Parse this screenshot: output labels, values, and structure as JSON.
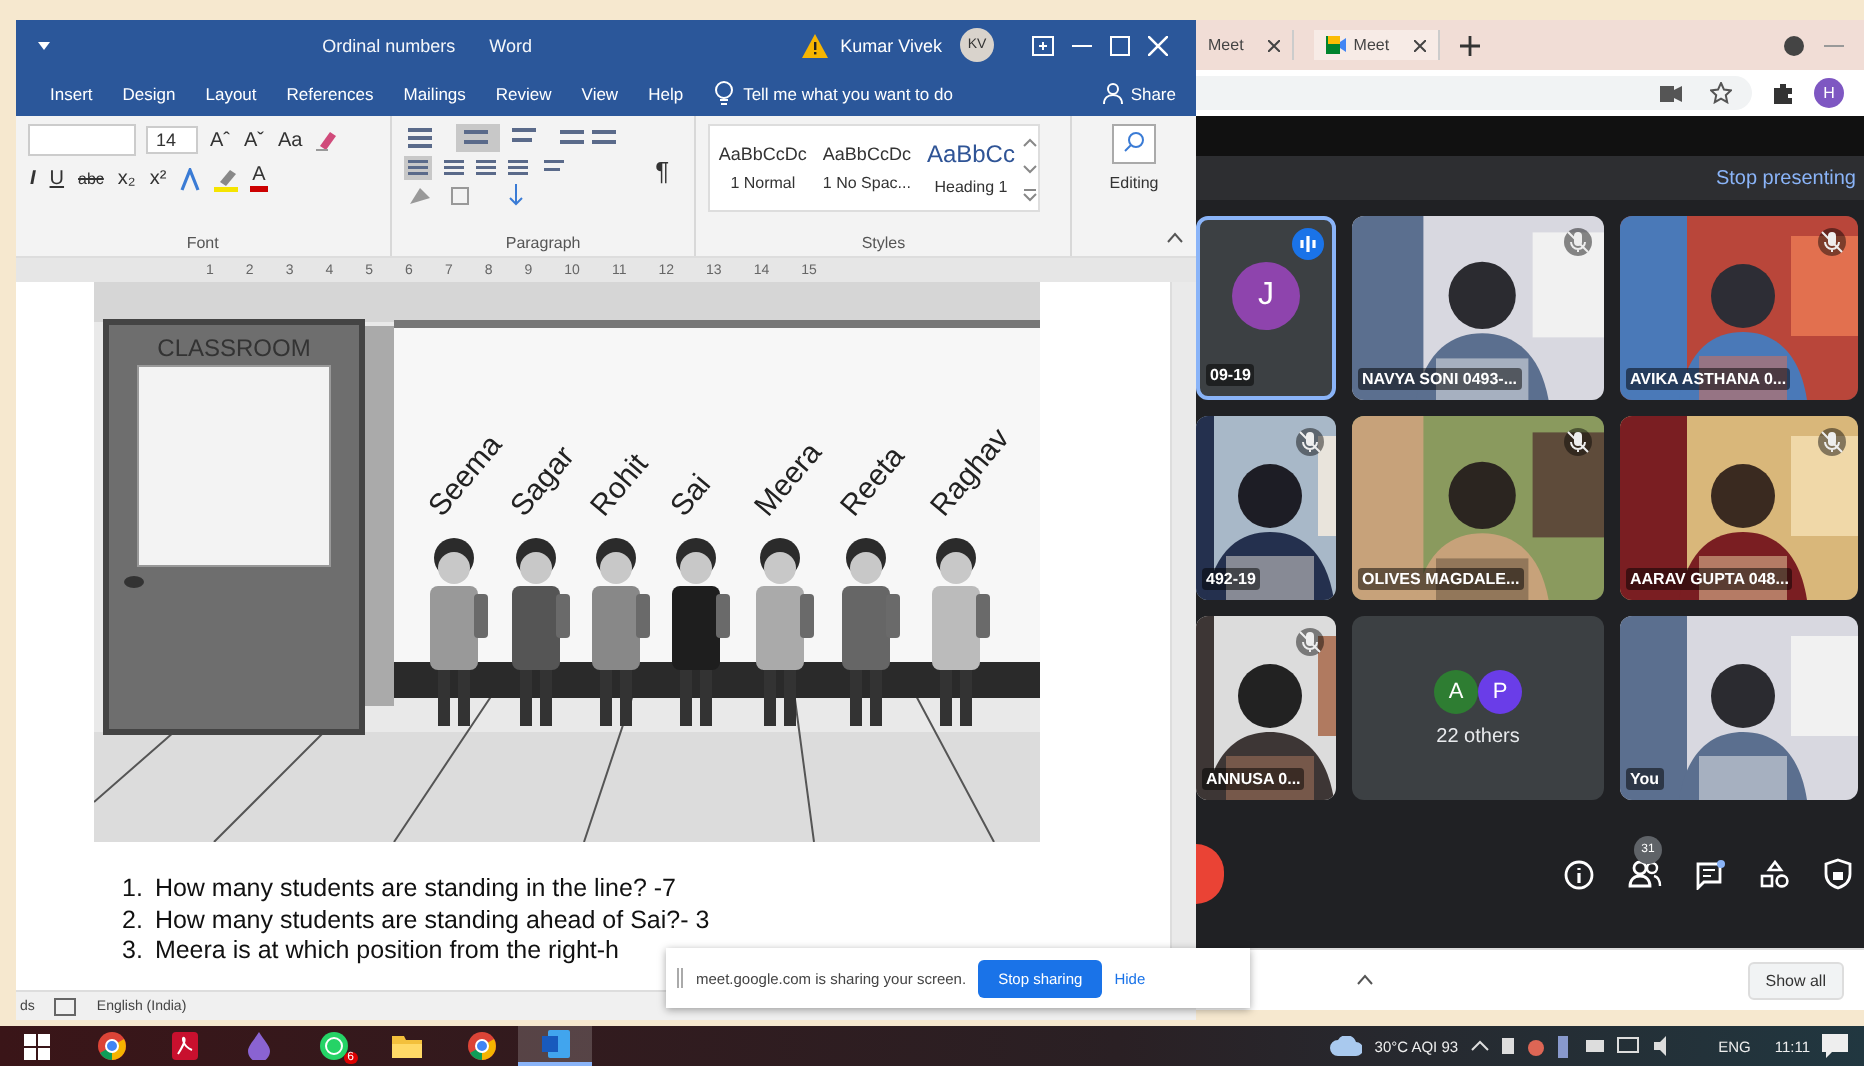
{
  "word": {
    "title": "Ordinal numbers",
    "app": "Word",
    "user": "Kumar Vivek",
    "user_initials": "KV",
    "tabs": [
      {
        "label": "Insert",
        "selected": false
      },
      {
        "label": "Design",
        "selected": false
      },
      {
        "label": "Layout",
        "selected": false
      },
      {
        "label": "References",
        "selected": false
      },
      {
        "label": "Mailings",
        "selected": false
      },
      {
        "label": "Review",
        "selected": false
      },
      {
        "label": "View",
        "selected": false
      },
      {
        "label": "Help",
        "selected": false
      }
    ],
    "tell_me": "Tell me what you want to do",
    "share": "Share",
    "font_size": "14",
    "font_row1": [
      "Aˆ",
      "Aˇ",
      "Aa"
    ],
    "font_row2": [
      "I",
      "U",
      "abc",
      "x₂",
      "x²"
    ],
    "font_color": "A",
    "pilcrow": "¶",
    "styles": [
      {
        "preview": "AaBbCcDc",
        "name": "1 Normal",
        "kind": "body"
      },
      {
        "preview": "AaBbCcDc",
        "name": "1 No Spac...",
        "kind": "body"
      },
      {
        "preview": "AaBbCc",
        "name": "Heading 1",
        "kind": "heading"
      }
    ],
    "groups": [
      "Font",
      "Paragraph",
      "Styles"
    ],
    "editing": "Editing",
    "ruler": [
      "1",
      "2",
      "3",
      "4",
      "5",
      "6",
      "7",
      "8",
      "9",
      "10",
      "11",
      "12",
      "13",
      "14",
      "15"
    ],
    "illustration": {
      "sign": "CLASSROOM",
      "students": [
        "Seema",
        "Sagar",
        "Rohit",
        "Sai",
        "Meera",
        "Reeta",
        "Raghav"
      ]
    },
    "questions": [
      {
        "number": "1.",
        "text": "How many students are standing in the line? -7"
      },
      {
        "number": "2.",
        "text": "How many students are standing ahead of Sai?- 3"
      },
      {
        "number": "3.",
        "text": "Meera is at which position from the right-h"
      }
    ],
    "status": {
      "left": "ds",
      "language": "English (India)"
    }
  },
  "share_popup": {
    "message": "meet.google.com is sharing your screen.",
    "stop": "Stop sharing",
    "hide": "Hide"
  },
  "browser": {
    "tabs": [
      {
        "label": "Meet",
        "selected": false
      },
      {
        "label": "Meet",
        "selected": true
      }
    ],
    "profile_initial": "H"
  },
  "meet": {
    "stop_presenting": "Stop presenting",
    "tiles": [
      {
        "kind": "avatar",
        "name": "09-19",
        "initial": "J",
        "speaking": true,
        "muted": false
      },
      {
        "kind": "video",
        "name": "NAVYA SONI 0493-...",
        "speaking": false,
        "muted": true
      },
      {
        "kind": "video",
        "name": "AVIKA ASTHANA 0...",
        "speaking": false,
        "muted": true
      },
      {
        "kind": "video",
        "name": "492-19",
        "speaking": false,
        "muted": true
      },
      {
        "kind": "video",
        "name": "OLIVES MAGDALE...",
        "speaking": false,
        "muted": true
      },
      {
        "kind": "video",
        "name": "AARAV GUPTA 048...",
        "speaking": false,
        "muted": true
      },
      {
        "kind": "video",
        "name": "ANNUSA 0...",
        "speaking": false,
        "muted": true
      },
      {
        "kind": "others",
        "name": "22 others",
        "speaking": false,
        "muted": false,
        "avatars": [
          {
            "initial": "A",
            "color": "#2e7d32"
          },
          {
            "initial": "P",
            "color": "#6a3de8"
          }
        ]
      },
      {
        "kind": "video",
        "name": "You",
        "speaking": false,
        "muted": false
      }
    ],
    "participants_count": "31"
  },
  "downloads": {
    "show_all": "Show all"
  },
  "taskbar": {
    "apps": [
      {
        "kind": "start",
        "selected": false
      },
      {
        "kind": "chrome",
        "selected": false
      },
      {
        "kind": "acrobat",
        "selected": false
      },
      {
        "kind": "drop",
        "selected": false
      },
      {
        "kind": "whatsapp",
        "selected": false,
        "badge": "6"
      },
      {
        "kind": "folder",
        "selected": false
      },
      {
        "kind": "chrome",
        "selected": false
      },
      {
        "kind": "word",
        "selected": true
      }
    ],
    "weather": "30°C  AQI 93",
    "language": "ENG",
    "time": "11:11"
  }
}
